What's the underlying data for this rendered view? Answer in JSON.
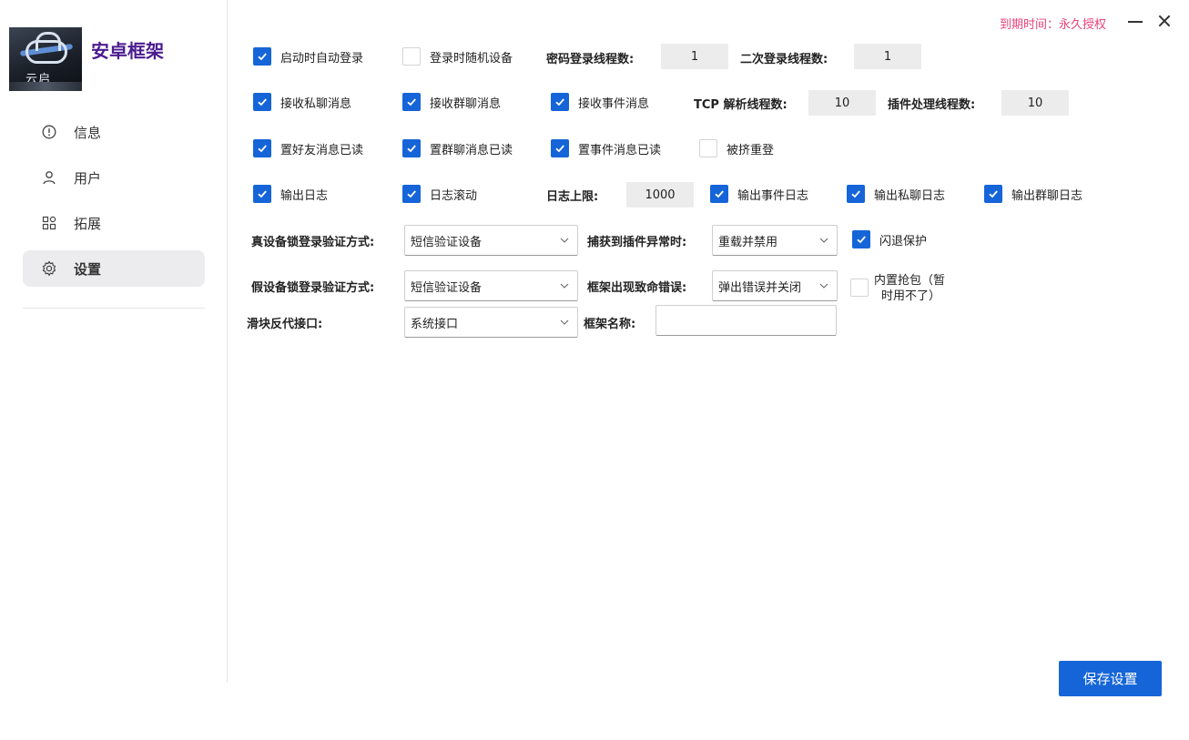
{
  "header": {
    "expiry_text": "到期时间：永久授权"
  },
  "brand": {
    "logo_text": "云启",
    "title": "安卓框架"
  },
  "sidebar": {
    "items": [
      {
        "label": "信息",
        "icon": "info-circle-icon"
      },
      {
        "label": "用户",
        "icon": "user-icon"
      },
      {
        "label": "拓展",
        "icon": "grid-apps-icon"
      },
      {
        "label": "设置",
        "icon": "gear-icon",
        "active": true
      }
    ]
  },
  "settings": {
    "auto_login": {
      "label": "启动时自动登录",
      "checked": true
    },
    "random_device": {
      "label": "登录时随机设备",
      "checked": false
    },
    "pwd_login_threads_label": "密码登录线程数:",
    "pwd_login_threads": "1",
    "second_login_threads_label": "二次登录线程数:",
    "second_login_threads": "1",
    "recv_private": {
      "label": "接收私聊消息",
      "checked": true
    },
    "recv_group": {
      "label": "接收群聊消息",
      "checked": true
    },
    "recv_event": {
      "label": "接收事件消息",
      "checked": true
    },
    "tcp_threads_label": "TCP 解析线程数:",
    "tcp_threads": "10",
    "plugin_threads_label": "插件处理线程数:",
    "plugin_threads": "10",
    "read_friend": {
      "label": "置好友消息已读",
      "checked": true
    },
    "read_group": {
      "label": "置群聊消息已读",
      "checked": true
    },
    "read_event": {
      "label": "置事件消息已读",
      "checked": true
    },
    "kicked_relogin": {
      "label": "被挤重登",
      "checked": false
    },
    "output_log": {
      "label": "输出日志",
      "checked": true
    },
    "log_scroll": {
      "label": "日志滚动",
      "checked": true
    },
    "log_limit_label": "日志上限:",
    "log_limit": "1000",
    "log_event": {
      "label": "输出事件日志",
      "checked": true
    },
    "log_private": {
      "label": "输出私聊日志",
      "checked": true
    },
    "log_group": {
      "label": "输出群聊日志",
      "checked": true
    },
    "real_device_label": "真设备锁登录验证方式:",
    "real_device_value": "短信验证设备",
    "plugin_exception_label": "捕获到插件异常时:",
    "plugin_exception_value": "重载并禁用",
    "crash_protect": {
      "label": "闪退保护",
      "checked": true
    },
    "fake_device_label": "假设备锁登录验证方式:",
    "fake_device_value": "短信验证设备",
    "fatal_error_label": "框架出现致命错误:",
    "fatal_error_value": "弹出错误并关闭",
    "builtin_capture": {
      "label_line1": "内置抢包（暂",
      "label_line2": "时用不了）",
      "checked": false
    },
    "slider_api_label": "滑块反代接口:",
    "slider_api_value": "系统接口",
    "frame_name_label": "框架名称:",
    "frame_name_value": ""
  },
  "actions": {
    "save_label": "保存设置"
  },
  "colors": {
    "accent": "#1565d8",
    "brand": "#4b1b8f",
    "expiry": "#e8437a"
  }
}
